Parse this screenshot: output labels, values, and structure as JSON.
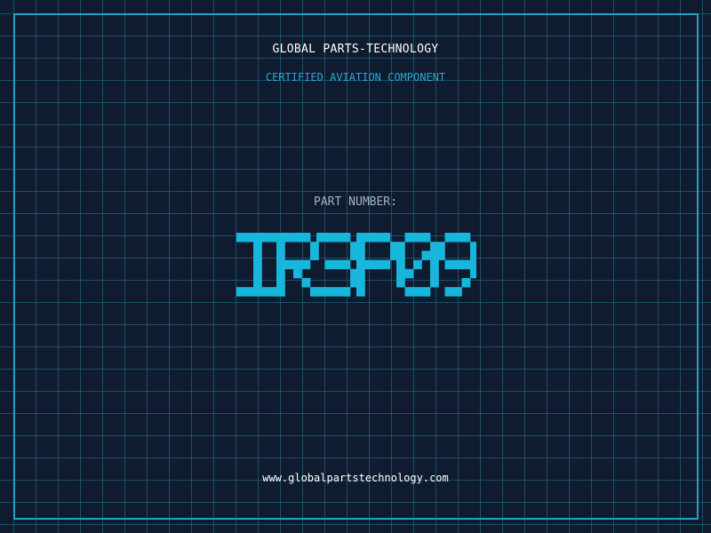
{
  "company": {
    "name": "GLOBAL PARTS-TECHNOLOGY",
    "subtitle": "CERTIFIED AVIATION COMPONENT"
  },
  "part": {
    "label": "PART NUMBER:",
    "number": "IR3P09"
  },
  "footer": {
    "website": "www.globalpartstechnology.com"
  },
  "colors": {
    "background": "#0f1b2e",
    "grid": "#1f6f8b",
    "frame": "#22a2c8",
    "accent": "#19b6dc",
    "title": "#ffffff",
    "label": "#a3b3c7"
  }
}
